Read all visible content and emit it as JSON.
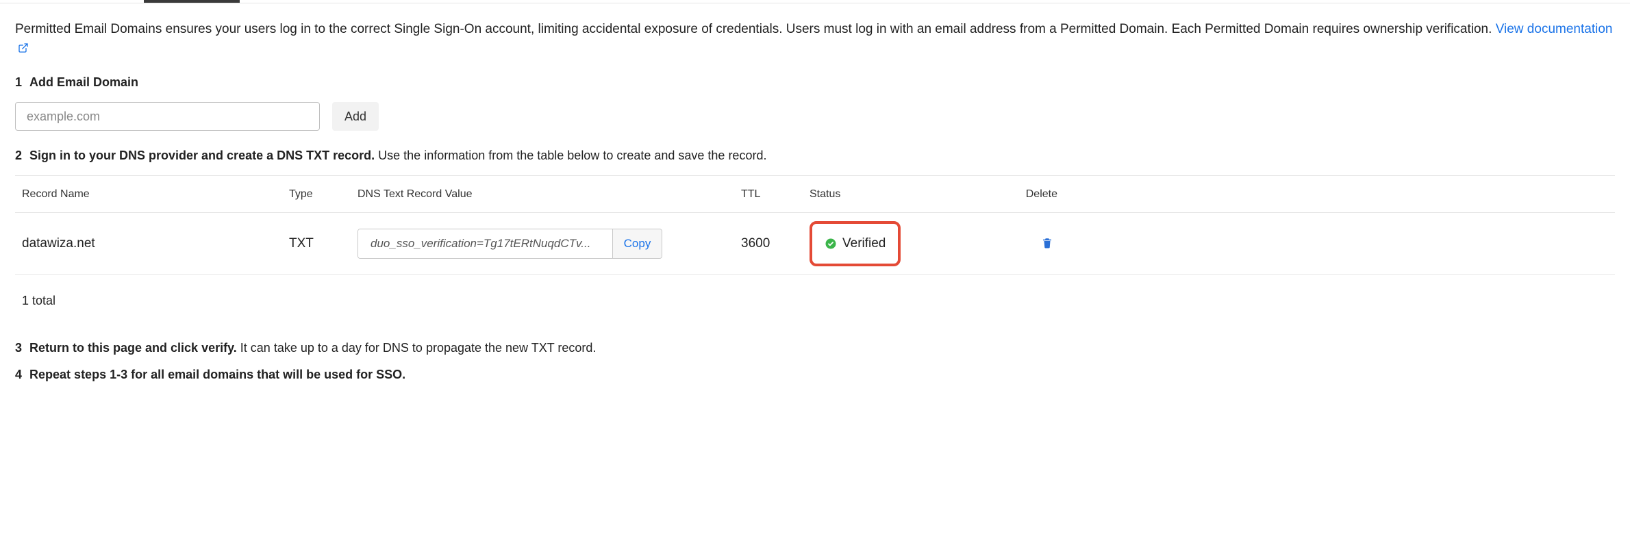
{
  "intro": {
    "description": "Permitted Email Domains ensures your users log in to the correct Single Sign-On account, limiting accidental exposure of credentials. Users must log in with an email address from a Permitted Domain. Each Permitted Domain requires ownership verification.",
    "doc_link_text": "View documentation"
  },
  "steps": {
    "s1": {
      "num": "1",
      "title": "Add Email Domain"
    },
    "s2": {
      "num": "2",
      "title": "Sign in to your DNS provider and create a DNS TXT record.",
      "extra": "Use the information from the table below to create and save the record."
    },
    "s3": {
      "num": "3",
      "title": "Return to this page and click verify.",
      "extra": "It can take up to a day for DNS to propagate the new TXT record."
    },
    "s4": {
      "num": "4",
      "title": "Repeat steps 1-3 for all email domains that will be used for SSO."
    }
  },
  "add_form": {
    "placeholder": "example.com",
    "value": "",
    "add_button": "Add"
  },
  "table": {
    "headers": {
      "record_name": "Record Name",
      "type": "Type",
      "txt_value": "DNS Text Record Value",
      "ttl": "TTL",
      "status": "Status",
      "delete": "Delete"
    },
    "rows": [
      {
        "record_name": "datawiza.net",
        "type": "TXT",
        "txt_value": "duo_sso_verification=Tg17tERtNuqdCTv...",
        "copy_label": "Copy",
        "ttl": "3600",
        "status": "Verified"
      }
    ],
    "total_label": "1 total"
  }
}
